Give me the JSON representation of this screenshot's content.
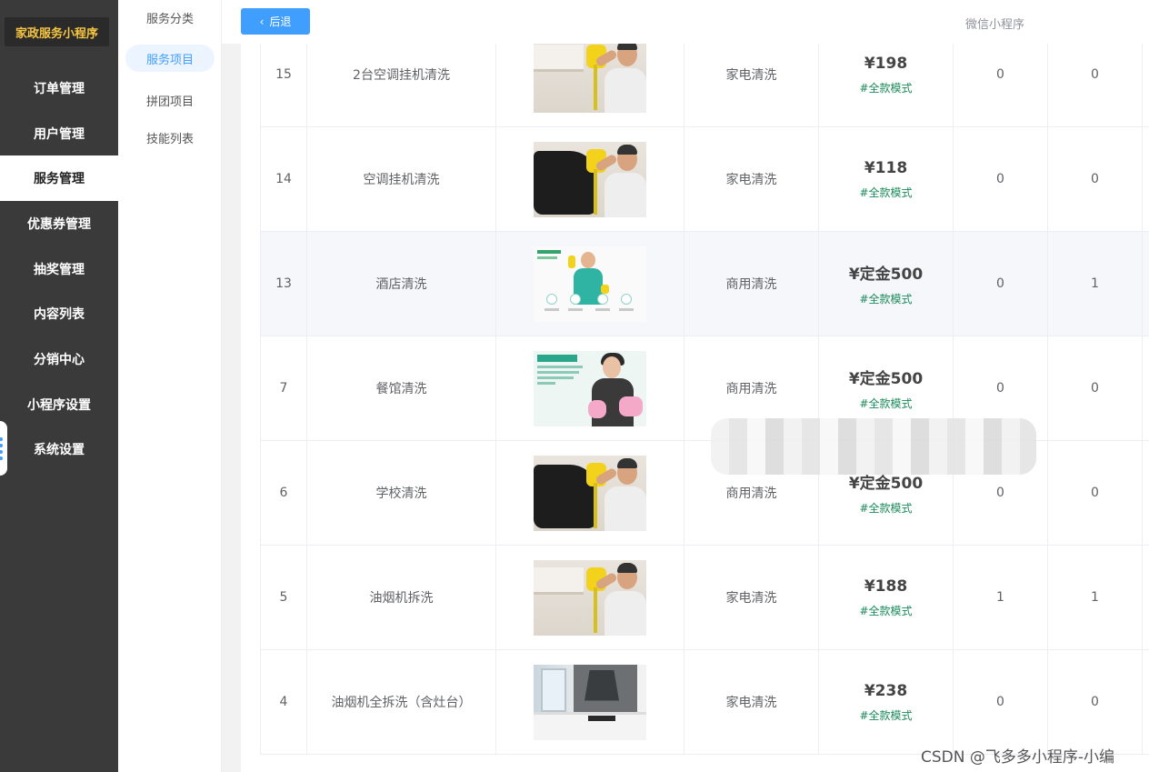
{
  "brand": {
    "title": "家政服务小程序"
  },
  "nav": {
    "items": [
      {
        "label": "订单管理"
      },
      {
        "label": "用户管理"
      },
      {
        "label": "服务管理"
      },
      {
        "label": "优惠券管理"
      },
      {
        "label": "抽奖管理"
      },
      {
        "label": "内容列表"
      },
      {
        "label": "分销中心"
      },
      {
        "label": "小程序设置"
      },
      {
        "label": "系统设置"
      }
    ],
    "active": "服务管理"
  },
  "submenu": {
    "items": [
      {
        "label": "服务分类"
      },
      {
        "label": "服务项目"
      },
      {
        "label": "拼团项目"
      },
      {
        "label": "技能列表"
      }
    ],
    "active": "服务项目"
  },
  "header": {
    "back_label": "后退",
    "mini_program_label": "微信小程序"
  },
  "table": {
    "rows": [
      {
        "id": "15",
        "name": "2台空调挂机清洗",
        "image": "ac-cleaning",
        "category": "家电清洗",
        "price": "¥198",
        "mode": "#全款模式",
        "col_a": "0",
        "col_b": "0"
      },
      {
        "id": "14",
        "name": "空调挂机清洗",
        "image": "ac-cleaning",
        "category": "家电清洗",
        "price": "¥118",
        "mode": "#全款模式",
        "col_a": "0",
        "col_b": "0"
      },
      {
        "id": "13",
        "name": "酒店清洗",
        "image": "hotel-cleaning",
        "category": "商用清洗",
        "price": "¥定金500",
        "mode": "#全款模式",
        "col_a": "0",
        "col_b": "1"
      },
      {
        "id": "7",
        "name": "餐馆清洗",
        "image": "daily-cleaning",
        "category": "商用清洗",
        "price": "¥定金500",
        "mode": "#全款模式",
        "col_a": "0",
        "col_b": "0"
      },
      {
        "id": "6",
        "name": "学校清洗",
        "image": "ac-cleaning",
        "category": "商用清洗",
        "price": "¥定金500",
        "mode": "#全款模式",
        "col_a": "0",
        "col_b": "0"
      },
      {
        "id": "5",
        "name": "油烟机拆洗",
        "image": "ac-cleaning",
        "category": "家电清洗",
        "price": "¥188",
        "mode": "#全款模式",
        "col_a": "1",
        "col_b": "1"
      },
      {
        "id": "4",
        "name": "油烟机全拆洗（含灶台）",
        "image": "kitchen",
        "category": "家电清洗",
        "price": "¥238",
        "mode": "#全款模式",
        "col_a": "0",
        "col_b": "0"
      }
    ]
  },
  "watermark": "CSDN @飞多多小程序-小编",
  "colors": {
    "primary": "#409eff",
    "sidebar": "#3a3a3a",
    "brand_text": "#f5c542",
    "mode_text": "#1a8a5a"
  }
}
